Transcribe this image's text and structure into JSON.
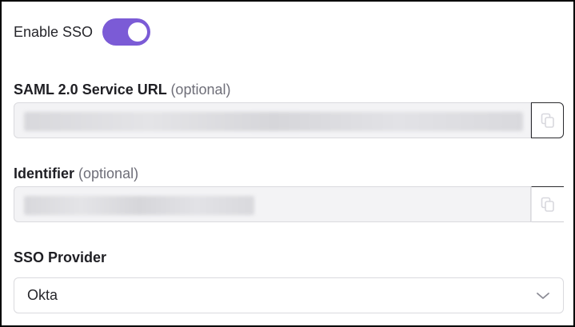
{
  "sso_toggle": {
    "label": "Enable SSO",
    "enabled": true,
    "color": "#7b5bd6"
  },
  "saml_url": {
    "label": "SAML 2.0 Service URL",
    "optional_text": "(optional)",
    "value_redacted": true
  },
  "identifier": {
    "label": "Identifier",
    "optional_text": "(optional)",
    "value_redacted": true
  },
  "sso_provider": {
    "label": "SSO Provider",
    "selected": "Okta"
  },
  "icons": {
    "copy": "copy-icon",
    "dropdown": "chevron-down-icon"
  }
}
